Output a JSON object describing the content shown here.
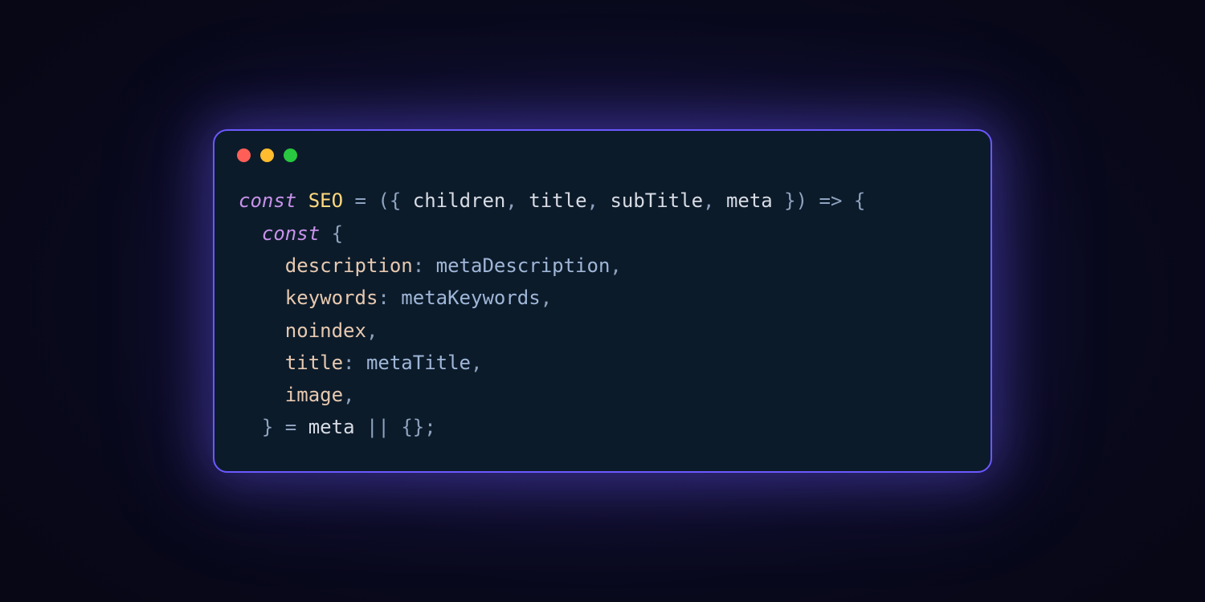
{
  "traffic_lights": [
    "red",
    "yellow",
    "green"
  ],
  "code": {
    "kw_const": "const",
    "fn_name": "SEO",
    "params": {
      "p0": "children",
      "p1": "title",
      "p2": "subTitle",
      "p3": "meta"
    },
    "keys": {
      "description": "description",
      "keywords": "keywords",
      "noindex": "noindex",
      "title": "title",
      "image": "image"
    },
    "aliases": {
      "metaDescription": "metaDescription",
      "metaKeywords": "metaKeywords",
      "metaTitle": "metaTitle"
    },
    "rhs_var": "meta",
    "op_eq": " = ",
    "op_or": " || ",
    "op_arrow": " => ",
    "brace_open": "{",
    "brace_close": "}",
    "paren_open": "(",
    "paren_close": ")",
    "obj_open": "{ ",
    "obj_close": " }",
    "empty_obj": "{}",
    "comma": ",",
    "colon": ": ",
    "semicolon": ";"
  }
}
